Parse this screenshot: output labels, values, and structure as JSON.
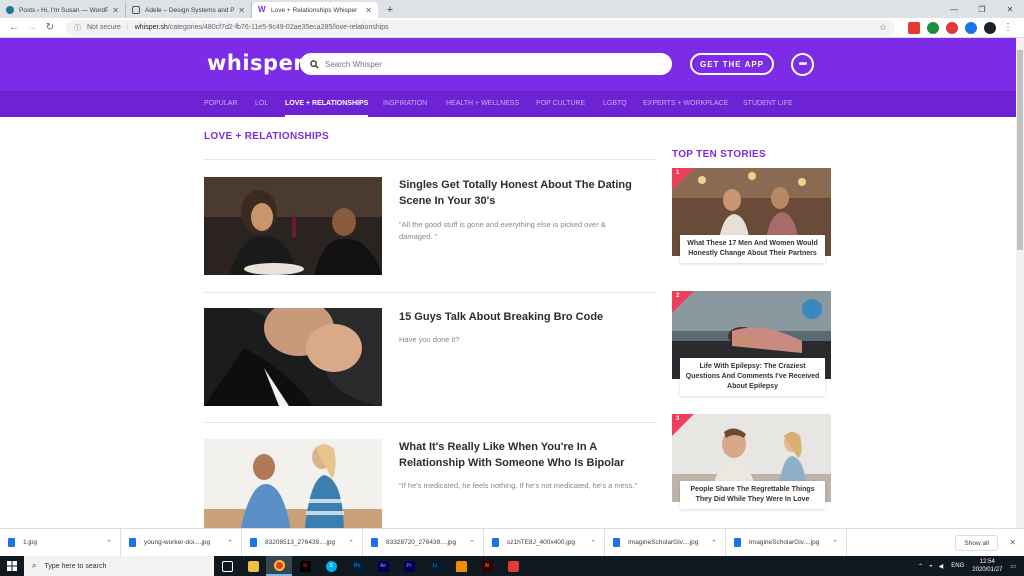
{
  "browser": {
    "tabs": [
      {
        "title": "Posts ‹ Hi, I'm Susan — WordPress",
        "favicon_color": "#21759b",
        "active": false
      },
      {
        "title": "Adele – Design Systems and Patt...",
        "favicon_color": "#ffffff",
        "active": false
      },
      {
        "title": "Love + Relationships Whisper",
        "favicon_color": "#7c2ce6",
        "active": true
      }
    ],
    "new_tab": "+",
    "security_label": "Not secure",
    "url_host": "whisper.sh",
    "url_path": "/categories/480cf7d2-fb76-11e5-9c49-02ae35eca285/love-relationships"
  },
  "header": {
    "logo": "whisper",
    "search_placeholder": "Search Whisper",
    "get_app": "GET THE APP",
    "more": "•••",
    "accent": "#7c2ce6"
  },
  "categories": [
    "POPULAR",
    "LOL",
    "LOVE + RELATIONSHIPS",
    "INSPIRATION",
    "HEALTH + WELLNESS",
    "POP CULTURE",
    "LGBTQ",
    "EXPERTS + WORKPLACE",
    "STUDENT LIFE"
  ],
  "active_category": "LOVE + RELATIONSHIPS",
  "section_title": "LOVE + RELATIONSHIPS",
  "articles": [
    {
      "title": "Singles Get Totally Honest About The Dating Scene In Your 30's",
      "desc": "\"All the good stuff is gone and everything else is picked over & damaged. \""
    },
    {
      "title": "15 Guys Talk About Breaking Bro Code",
      "desc": "Have you done it?"
    },
    {
      "title": "What It's Really Like When You're In A Relationship With Someone Who Is Bipolar",
      "desc": "\"If he's medicated, he feels nothing. If he's not medicated, he's a mess.\""
    }
  ],
  "top_ten": {
    "title": "TOP TEN STORIES",
    "stories": [
      {
        "rank": "1",
        "caption": "What These 17 Men And Women Would Honestly Change About Their Partners"
      },
      {
        "rank": "2",
        "caption": "Life With Epilepsy: The Craziest Questions And Comments I've Received About Epilepsy"
      },
      {
        "rank": "3",
        "caption": "People Share The Regrettable Things They Did While They Were In Love"
      }
    ]
  },
  "downloads": [
    "1.jpg",
    "young-worker-doi....jpg",
    "83208513_276439....jpg",
    "83328720_276439....jpg",
    "sz1hTE8J_400x400.jpg",
    "ImagineScholarGiv....jpg",
    "ImagineScholarGiv....jpg"
  ],
  "show_all": "Show all",
  "taskbar": {
    "search_placeholder": "Type here to search",
    "lang": "ENG",
    "time": "12:54",
    "date": "2020/01/27"
  }
}
